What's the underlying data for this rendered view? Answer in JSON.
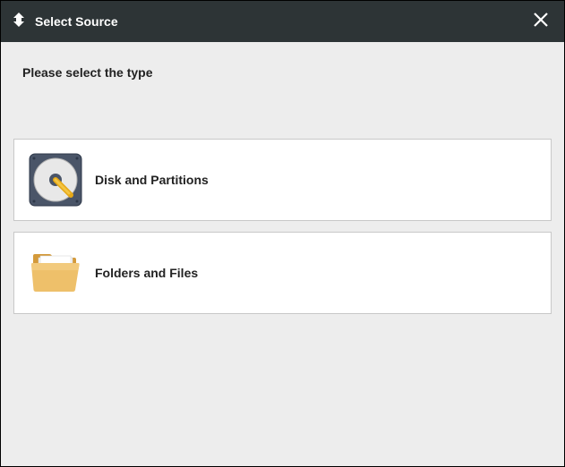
{
  "titlebar": {
    "title": "Select Source"
  },
  "content": {
    "prompt": "Please select the type"
  },
  "options": [
    {
      "label": "Disk and Partitions",
      "icon": "disk-icon"
    },
    {
      "label": "Folders and Files",
      "icon": "folder-icon"
    }
  ]
}
